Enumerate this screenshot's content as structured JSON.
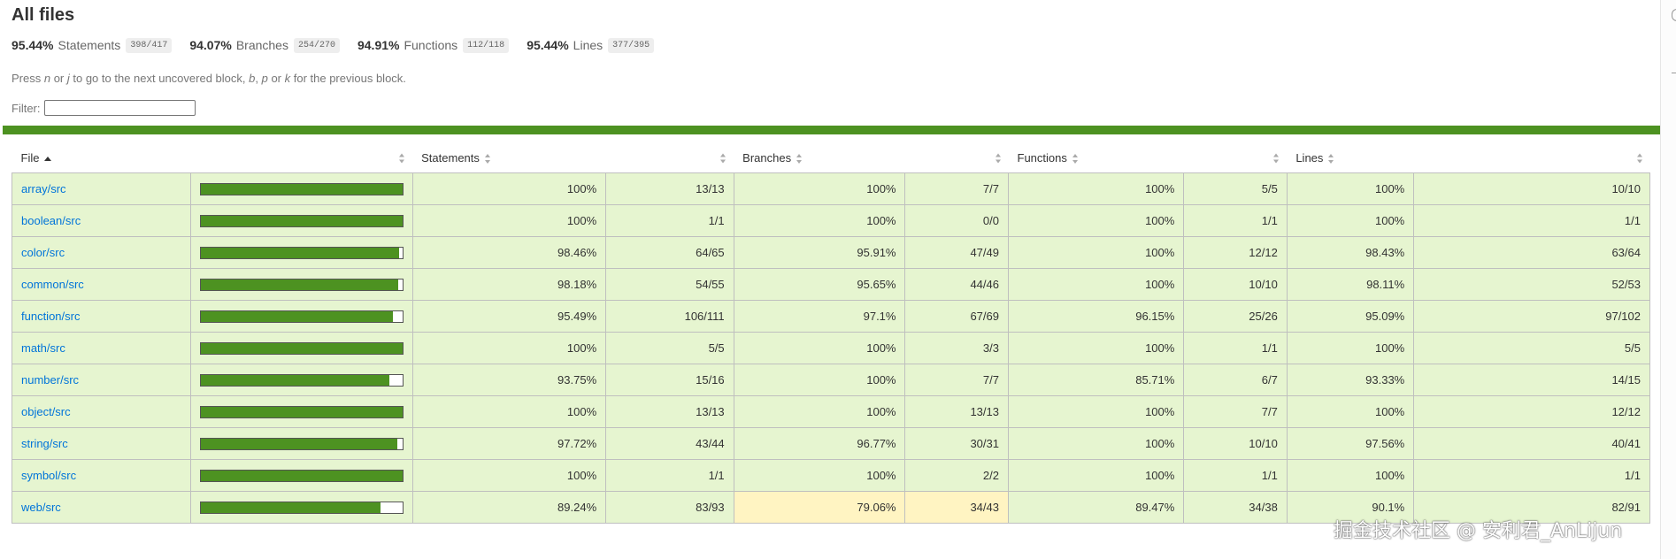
{
  "page": {
    "title": "All files",
    "summary": [
      {
        "pct": "95.44%",
        "label": "Statements",
        "frac": "398/417"
      },
      {
        "pct": "94.07%",
        "label": "Branches",
        "frac": "254/270"
      },
      {
        "pct": "94.91%",
        "label": "Functions",
        "frac": "112/118"
      },
      {
        "pct": "95.44%",
        "label": "Lines",
        "frac": "377/395"
      }
    ],
    "hint": {
      "p1": "Press ",
      "k1": "n",
      "p2": " or ",
      "k2": "j",
      "p3": " to go to the next uncovered block, ",
      "k3": "b",
      "p4": ", ",
      "k4": "p",
      "p5": " or ",
      "k5": "k",
      "p6": " for the previous block."
    },
    "filter_label": "Filter:",
    "filter_value": ""
  },
  "colors": {
    "high_row": "#e6f5d0",
    "medium_cell": "#fff4c2",
    "bar_fill": "#4d9221",
    "link": "#0074d9"
  },
  "table": {
    "headers": {
      "file": "File",
      "statements": "Statements",
      "branches": "Branches",
      "functions": "Functions",
      "lines": "Lines"
    },
    "rows": [
      {
        "file": "array/src",
        "coverage": 100,
        "stmt_pct": "100%",
        "stmt_frac": "13/13",
        "br_pct": "100%",
        "br_frac": "7/7",
        "fn_pct": "100%",
        "fn_frac": "5/5",
        "ln_pct": "100%",
        "ln_frac": "10/10",
        "branch_level": "high"
      },
      {
        "file": "boolean/src",
        "coverage": 100,
        "stmt_pct": "100%",
        "stmt_frac": "1/1",
        "br_pct": "100%",
        "br_frac": "0/0",
        "fn_pct": "100%",
        "fn_frac": "1/1",
        "ln_pct": "100%",
        "ln_frac": "1/1",
        "branch_level": "high"
      },
      {
        "file": "color/src",
        "coverage": 98.46,
        "stmt_pct": "98.46%",
        "stmt_frac": "64/65",
        "br_pct": "95.91%",
        "br_frac": "47/49",
        "fn_pct": "100%",
        "fn_frac": "12/12",
        "ln_pct": "98.43%",
        "ln_frac": "63/64",
        "branch_level": "high"
      },
      {
        "file": "common/src",
        "coverage": 98.18,
        "stmt_pct": "98.18%",
        "stmt_frac": "54/55",
        "br_pct": "95.65%",
        "br_frac": "44/46",
        "fn_pct": "100%",
        "fn_frac": "10/10",
        "ln_pct": "98.11%",
        "ln_frac": "52/53",
        "branch_level": "high"
      },
      {
        "file": "function/src",
        "coverage": 95.49,
        "stmt_pct": "95.49%",
        "stmt_frac": "106/111",
        "br_pct": "97.1%",
        "br_frac": "67/69",
        "fn_pct": "96.15%",
        "fn_frac": "25/26",
        "ln_pct": "95.09%",
        "ln_frac": "97/102",
        "branch_level": "high"
      },
      {
        "file": "math/src",
        "coverage": 100,
        "stmt_pct": "100%",
        "stmt_frac": "5/5",
        "br_pct": "100%",
        "br_frac": "3/3",
        "fn_pct": "100%",
        "fn_frac": "1/1",
        "ln_pct": "100%",
        "ln_frac": "5/5",
        "branch_level": "high"
      },
      {
        "file": "number/src",
        "coverage": 93.75,
        "stmt_pct": "93.75%",
        "stmt_frac": "15/16",
        "br_pct": "100%",
        "br_frac": "7/7",
        "fn_pct": "85.71%",
        "fn_frac": "6/7",
        "ln_pct": "93.33%",
        "ln_frac": "14/15",
        "branch_level": "high"
      },
      {
        "file": "object/src",
        "coverage": 100,
        "stmt_pct": "100%",
        "stmt_frac": "13/13",
        "br_pct": "100%",
        "br_frac": "13/13",
        "fn_pct": "100%",
        "fn_frac": "7/7",
        "ln_pct": "100%",
        "ln_frac": "12/12",
        "branch_level": "high"
      },
      {
        "file": "string/src",
        "coverage": 97.72,
        "stmt_pct": "97.72%",
        "stmt_frac": "43/44",
        "br_pct": "96.77%",
        "br_frac": "30/31",
        "fn_pct": "100%",
        "fn_frac": "10/10",
        "ln_pct": "97.56%",
        "ln_frac": "40/41",
        "branch_level": "high"
      },
      {
        "file": "symbol/src",
        "coverage": 100,
        "stmt_pct": "100%",
        "stmt_frac": "1/1",
        "br_pct": "100%",
        "br_frac": "2/2",
        "fn_pct": "100%",
        "fn_frac": "1/1",
        "ln_pct": "100%",
        "ln_frac": "1/1",
        "branch_level": "high"
      },
      {
        "file": "web/src",
        "coverage": 89.24,
        "stmt_pct": "89.24%",
        "stmt_frac": "83/93",
        "br_pct": "79.06%",
        "br_frac": "34/43",
        "fn_pct": "89.47%",
        "fn_frac": "34/38",
        "ln_pct": "90.1%",
        "ln_frac": "82/91",
        "branch_level": "medium"
      }
    ]
  },
  "watermark": "掘金技术社区 @ 安利君_AnLijun"
}
